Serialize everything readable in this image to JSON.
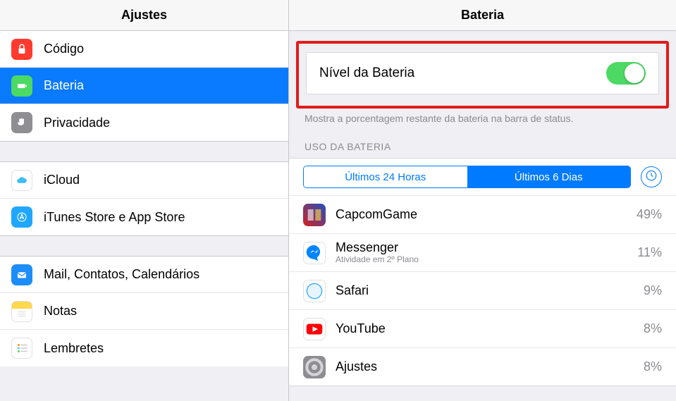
{
  "leftHeader": "Ajustes",
  "rightHeader": "Bateria",
  "sidebar": {
    "group1": [
      {
        "label": "Código"
      },
      {
        "label": "Bateria"
      },
      {
        "label": "Privacidade"
      }
    ],
    "group2": [
      {
        "label": "iCloud"
      },
      {
        "label": "iTunes Store e App Store"
      }
    ],
    "group3": [
      {
        "label": "Mail, Contatos, Calendários"
      },
      {
        "label": "Notas"
      },
      {
        "label": "Lembretes"
      }
    ]
  },
  "battery": {
    "toggleLabel": "Nível da Bateria",
    "helpText": "Mostra a porcentagem restante da bateria na barra de status.",
    "usageHeader": "USO DA BATERIA",
    "seg1": "Últimos 24 Horas",
    "seg2": "Últimos 6 Dias",
    "apps": [
      {
        "name": "CapcomGame",
        "sub": "",
        "pct": "49%"
      },
      {
        "name": "Messenger",
        "sub": "Atividade em 2º Plano",
        "pct": "11%"
      },
      {
        "name": "Safari",
        "sub": "",
        "pct": "9%"
      },
      {
        "name": "YouTube",
        "sub": "",
        "pct": "8%"
      },
      {
        "name": "Ajustes",
        "sub": "",
        "pct": "8%"
      }
    ]
  }
}
